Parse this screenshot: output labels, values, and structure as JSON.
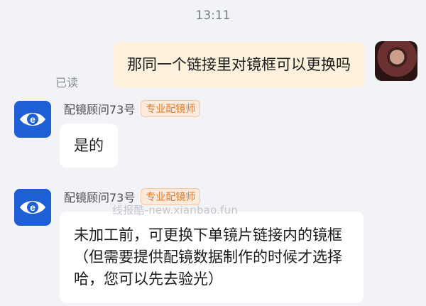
{
  "timestamp": "13:11",
  "outgoing": {
    "text": "那同一个链接里对镜框可以更换吗",
    "status": "已读"
  },
  "agent": {
    "name": "配镜顾问73号",
    "badge": "专业配镜师"
  },
  "incoming": [
    {
      "text": "是的"
    },
    {
      "text": "未加工前，可更换下单镜片链接内的镜框（但需要提供配镜数据制作的时候才选择哈，您可以先去验光）"
    }
  ],
  "watermark": "线报酷-new.xianbao.fun",
  "colors": {
    "agent_avatar": "#1e5fd6",
    "outgoing_bubble": "#fdf1dc",
    "badge_text": "#e07a2d"
  }
}
